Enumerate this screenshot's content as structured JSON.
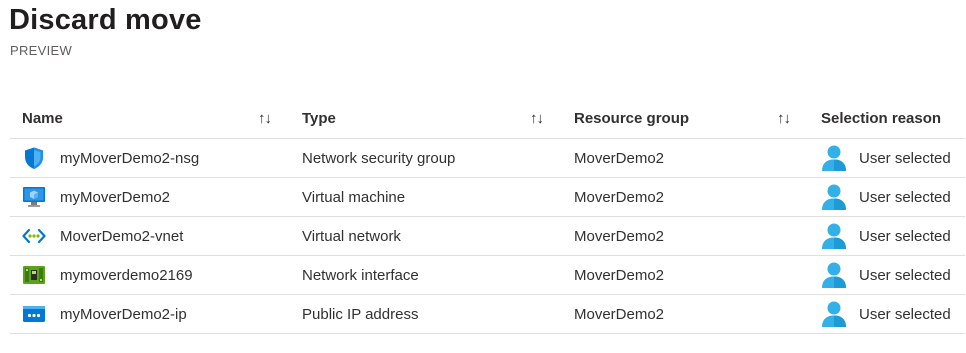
{
  "page": {
    "title": "Discard move",
    "subtitle": "PREVIEW"
  },
  "table": {
    "columns": [
      {
        "label": "Name",
        "sort_icon": "↑↓"
      },
      {
        "label": "Type",
        "sort_icon": "↑↓"
      },
      {
        "label": "Resource group",
        "sort_icon": "↑↓"
      },
      {
        "label": "Selection reason"
      }
    ],
    "rows": [
      {
        "name": "myMoverDemo2-nsg",
        "type": "Network security group",
        "resource_group": "MoverDemo2",
        "reason": "User selected",
        "icon": "network-security-group-icon"
      },
      {
        "name": "myMoverDemo2",
        "type": "Virtual machine",
        "resource_group": "MoverDemo2",
        "reason": "User selected",
        "icon": "virtual-machine-icon"
      },
      {
        "name": "MoverDemo2-vnet",
        "type": "Virtual network",
        "resource_group": "MoverDemo2",
        "reason": "User selected",
        "icon": "virtual-network-icon"
      },
      {
        "name": "mymoverdemo2169",
        "type": "Network interface",
        "resource_group": "MoverDemo2",
        "reason": "User selected",
        "icon": "network-interface-icon"
      },
      {
        "name": "myMoverDemo2-ip",
        "type": "Public IP address",
        "resource_group": "MoverDemo2",
        "reason": "User selected",
        "icon": "public-ip-address-icon"
      }
    ]
  },
  "colors": {
    "azure_blue": "#0078d4",
    "user_icon_blue": "#32b0e7",
    "nic_green": "#5ea11a",
    "divider": "#e1dfdd"
  }
}
